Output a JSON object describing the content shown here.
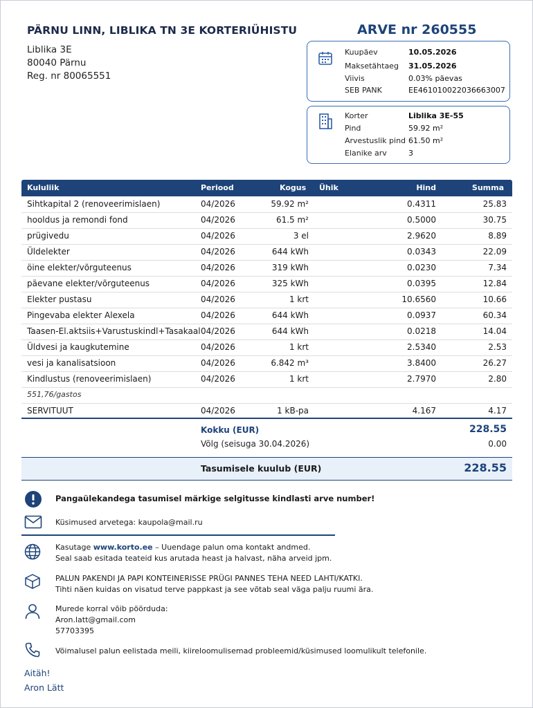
{
  "header": {
    "org_name": "PÄRNU LINN, LIBLIKA TN 3E KORTERIÜHISTU",
    "address_line1": "Liblika 3E",
    "address_line2": "80040 Pärnu",
    "reg_line": "Reg. nr 80065551",
    "invoice_title": "ARVE nr 260555"
  },
  "invoice_box": {
    "icon": "calendar-icon",
    "rows": [
      {
        "label": "Kuupäev",
        "value": "10.05.2026"
      },
      {
        "label": "Maksetähtaeg",
        "value": "31.05.2026"
      },
      {
        "label": "Viivis",
        "value": "0.03% päevas"
      },
      {
        "label": "SEB PANK",
        "value": "EE461010022036663007"
      }
    ]
  },
  "apartment_box": {
    "icon": "building-icon",
    "rows": [
      {
        "label": "Korter",
        "value": "Liblika 3E-55"
      },
      {
        "label": "Pind",
        "value": "59.92 m²"
      },
      {
        "label": "Arvestuslik pind",
        "value": "61.50 m²"
      },
      {
        "label": "Elanike arv",
        "value": "3"
      }
    ]
  },
  "table": {
    "headers": {
      "kululiik": "Kululiik",
      "periood": "Periood",
      "kogus": "Kogus",
      "uhik": "Ühik",
      "hind": "Hind",
      "summa": "Summa"
    },
    "rows": [
      {
        "name": "Sihtkapital 2 (renoveerimislaen)",
        "period": "04/2026",
        "qty": "59.92 m²",
        "price": "0.4311",
        "sum": "25.83"
      },
      {
        "name": "hooldus ja remondi fond",
        "period": "04/2026",
        "qty": "61.5 m²",
        "price": "0.5000",
        "sum": "30.75"
      },
      {
        "name": "prügivedu",
        "period": "04/2026",
        "qty": "3 el",
        "price": "2.9620",
        "sum": "8.89"
      },
      {
        "name": "Üldelekter",
        "period": "04/2026",
        "qty": "644 kWh",
        "price": "0.0343",
        "sum": "22.09"
      },
      {
        "name": "öine elekter/võrguteenus",
        "period": "04/2026",
        "qty": "319 kWh",
        "price": "0.0230",
        "sum": "7.34"
      },
      {
        "name": "päevane elekter/võrguteenus",
        "period": "04/2026",
        "qty": "325 kWh",
        "price": "0.0395",
        "sum": "12.84"
      },
      {
        "name": "Elekter pustasu",
        "period": "04/2026",
        "qty": "1 krt",
        "price": "10.6560",
        "sum": "10.66"
      },
      {
        "name": "Pingevaba elekter Alexela",
        "period": "04/2026",
        "qty": "644 kWh",
        "price": "0.0937",
        "sum": "60.34"
      },
      {
        "name": "Taasen-El.aktsiis+Varustuskindl+Tasakaal",
        "period": "04/2026",
        "qty": "644 kWh",
        "price": "0.0218",
        "sum": "14.04"
      },
      {
        "name": "Üldvesi ja kaugkutemine",
        "period": "04/2026",
        "qty": "1 krt",
        "price": "2.5340",
        "sum": "2.53"
      },
      {
        "name": "vesi ja kanalisatsioon",
        "period": "04/2026",
        "qty": "6.842 m³",
        "price": "3.8400",
        "sum": "26.27"
      },
      {
        "name": "Kindlustus (renoveerimislaen)",
        "period": "04/2026",
        "qty": "1 krt",
        "price": "2.7970",
        "sum": "2.80"
      }
    ],
    "note": "551,76/gastos",
    "servituut": {
      "name": "SERVITUUT",
      "period": "04/2026",
      "qty": "1 kB-pa",
      "price": "4.167",
      "sum": "4.17"
    }
  },
  "totals": {
    "kokku_label": "Kokku (EUR)",
    "kokku_value": "228.55",
    "volg_label": "Võlg (seisuga 30.04.2026)",
    "volg_value": "0.00",
    "pay_label": "Tasumisele kuulub (EUR)",
    "pay_value": "228.55"
  },
  "info": {
    "notice": "Pangaülekandega tasumisel märkige selgitusse kindlasti arve number!",
    "questions": "Küsimused arvetega: kaupola@mail.ru",
    "web_prefix": "Kasutage ",
    "web_link": "www.korto.ee",
    "web_suffix": " – Uuendage palun oma kontakt andmed.",
    "web_line2": "Seal saab esitada teateid kus arutada heast ja halvast, näha arveid jpm.",
    "bins_line1": "PALUN PAKENDI JA PAPI KONTEINERISSE PRÜGI PANNES TEHA NEED LAHTI/KATKI.",
    "bins_line2": "Tihti näen kuidas on visatud terve pappkast ja see võtab seal väga palju ruumi ära.",
    "contact_line1": "Murede korral võib pöörduda:",
    "contact_line2": "Aron.latt@gmail.com",
    "contact_line3": "57703395",
    "phone_note": "Võimalusel palun eelistada meili, kiireloomulisemad probleemid/küsimused loomulikult telefonile."
  },
  "signature": {
    "thanks": "Aitäh!",
    "name": "Aron Lätt"
  },
  "colors": {
    "accent": "#1d4379",
    "box_border": "#3a6db5",
    "pay_band": "#e8f0fa"
  }
}
